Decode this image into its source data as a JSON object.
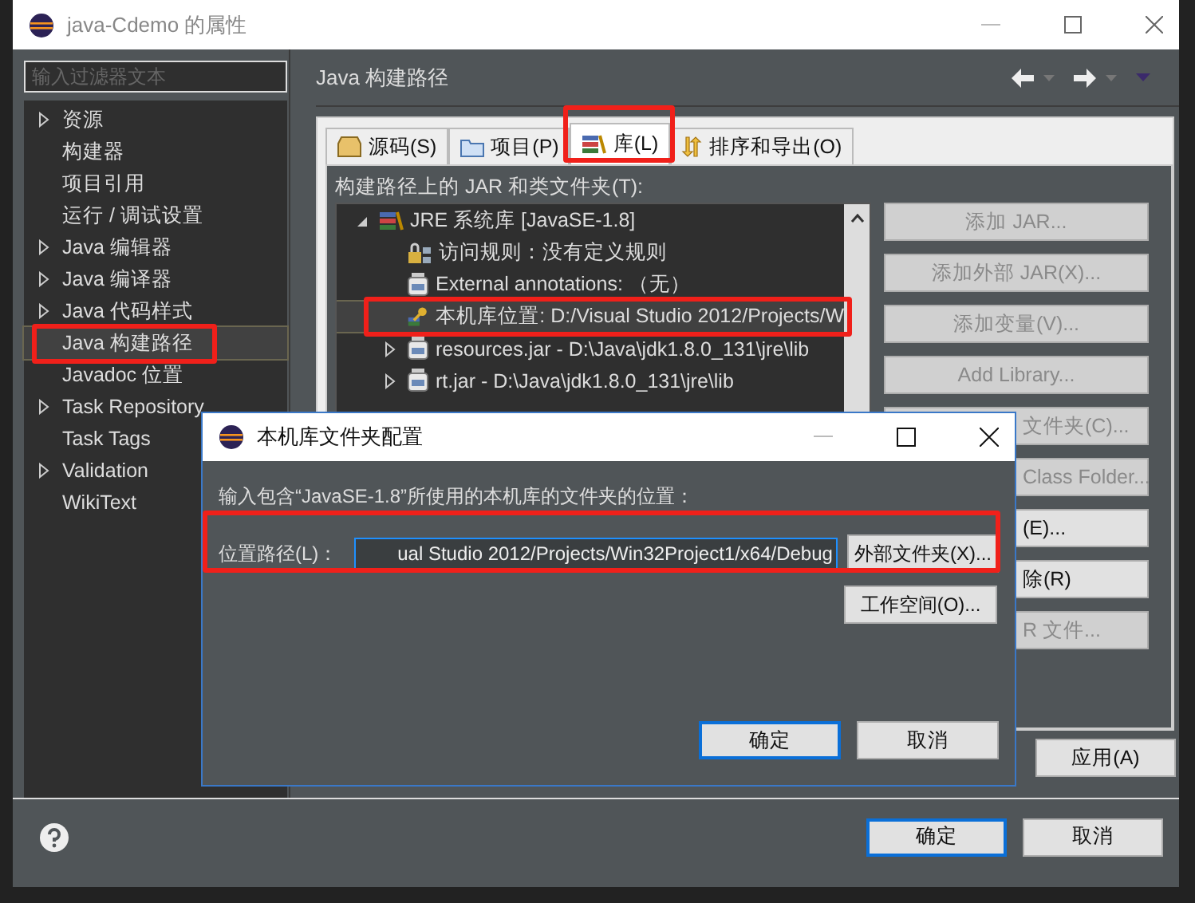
{
  "window": {
    "title": "java-Cdemo 的属性"
  },
  "filter": {
    "placeholder": "输入过滤器文本"
  },
  "sidebar": {
    "items": [
      {
        "label": "资源",
        "expanded": false,
        "selected": false
      },
      {
        "label": "构建器",
        "selected": false
      },
      {
        "label": "项目引用",
        "selected": false
      },
      {
        "label": "运行 / 调试设置",
        "selected": false
      },
      {
        "label": "Java 编辑器",
        "expanded": false,
        "selected": false
      },
      {
        "label": "Java 编译器",
        "expanded": false,
        "selected": false
      },
      {
        "label": "Java 代码样式",
        "expanded": false,
        "selected": false
      },
      {
        "label": "Java 构建路径",
        "selected": true
      },
      {
        "label": "Javadoc 位置",
        "selected": false
      },
      {
        "label": "Task Repository",
        "expanded": false,
        "selected": false
      },
      {
        "label": "Task Tags",
        "selected": false
      },
      {
        "label": "Validation",
        "expanded": false,
        "selected": false
      },
      {
        "label": "WikiText",
        "selected": false
      }
    ]
  },
  "page": {
    "title": "Java 构建路径"
  },
  "tabs": [
    {
      "label": "源码(S)",
      "kind": "source",
      "selected": false
    },
    {
      "label": "项目(P)",
      "kind": "project",
      "selected": false
    },
    {
      "label": "库(L)",
      "kind": "library",
      "selected": true
    },
    {
      "label": "排序和导出(O)",
      "kind": "order",
      "selected": false
    }
  ],
  "libraries": {
    "label": "构建路径上的 JAR 和类文件夹(T):",
    "tree": [
      {
        "text": "JRE 系统库 [JavaSE-1.8]",
        "kind": "library",
        "expanded": true,
        "selected": false,
        "children": [
          {
            "text": "访问规则：没有定义规则",
            "kind": "rules",
            "selected": false
          },
          {
            "text": "External annotations: （无）",
            "kind": "jar",
            "selected": false
          },
          {
            "text": "本机库位置: D:/Visual Studio 2012/Projects/W",
            "kind": "native",
            "selected": true
          },
          {
            "text": "resources.jar - D:\\Java\\jdk1.8.0_131\\jre\\lib",
            "kind": "jar",
            "expanded": false,
            "selected": false
          },
          {
            "text": "rt.jar - D:\\Java\\jdk1.8.0_131\\jre\\lib",
            "kind": "jar",
            "expanded": false,
            "selected": false
          }
        ]
      }
    ]
  },
  "side_buttons": [
    {
      "label": "添加 JAR...",
      "disabled": true
    },
    {
      "label": "添加外部 JAR(X)...",
      "disabled": true
    },
    {
      "label": "添加变量(V)...",
      "disabled": true
    },
    {
      "label": "Add Library...",
      "disabled": true
    },
    {
      "label": "文件夹(C)...",
      "disabled": true
    },
    {
      "label": "Class Folder...",
      "disabled": true
    },
    {
      "label": "(E)...",
      "disabled": false
    },
    {
      "label": "除(R)",
      "disabled": false
    },
    {
      "label": "R 文件...",
      "disabled": true
    }
  ],
  "apply_button": {
    "label": "应用(A)"
  },
  "annotations": [
    {
      "kind": "sidebar"
    },
    {
      "kind": "tab"
    },
    {
      "kind": "tree-row"
    },
    {
      "kind": "path-row"
    }
  ],
  "footer": {
    "buttons": [
      {
        "label": "确定",
        "default": true
      },
      {
        "label": "取消",
        "default": false
      }
    ]
  },
  "dialog": {
    "title": "本机库文件夹配置",
    "prompt": "输入包含“JavaSE-1.8”所使用的本机库的文件夹的位置：",
    "field_label": "位置路径(L)：",
    "value": "ual Studio 2012/Projects/Win32Project1/x64/Debug",
    "side_buttons": [
      {
        "label": "外部文件夹(X)..."
      },
      {
        "label": "工作空间(O)..."
      }
    ],
    "buttons": [
      {
        "label": "确定",
        "default": true
      },
      {
        "label": "取消",
        "default": false
      }
    ]
  }
}
